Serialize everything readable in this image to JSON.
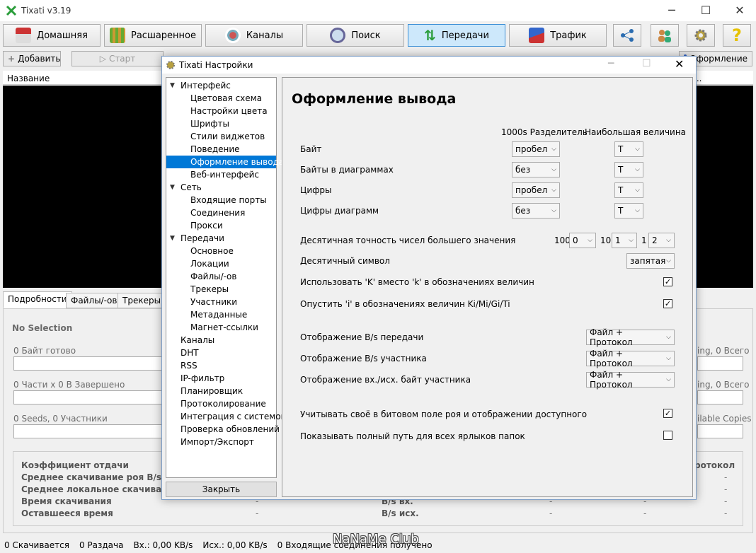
{
  "app": {
    "title": "Tixati v3.19",
    "minimize": "─",
    "maximize": "☐",
    "close": "✕"
  },
  "toolbar": {
    "home": "Домашняя",
    "advanced": "Расшаренное",
    "channels": "Каналы",
    "search": "Поиск",
    "transfers": "Передачи",
    "traffic": "Трафик"
  },
  "row2": {
    "add": "Добавить",
    "start": "Старт",
    "appearance": "Оформление"
  },
  "list": {
    "col_name": "Название",
    "dots": "..."
  },
  "bottom_tabs": [
    "Подробности",
    "Файлы/-ов",
    "Трекеры"
  ],
  "details": {
    "no_selection": "No Selection",
    "bytes_ready": "0 Байт готово",
    "parts": "0 Части  x  0 В Завершено",
    "seeds": "0 Seeds, 0 Участники",
    "right1": "ing, 0 Всего",
    "right2": "ing, 0 Всего",
    "right3": "ilable Copies",
    "stats_labels": [
      "Коэффициент отдачи",
      "Среднее скачивание роя B/s",
      "Среднее локальное скачивание B/s",
      "Время скачивания",
      "Оставшееся время"
    ],
    "bs_in": "B/s вх.",
    "bs_out": "B/s исх.",
    "protocol": "ротокол",
    "dash": "-"
  },
  "status": {
    "downloading": "0 Скачивается",
    "seeding": "0 Раздача",
    "in": "Вх.: 0,00 KB/s",
    "out": "Исх.: 0,00 KB/s",
    "incoming": "0 Входящие соединения получено"
  },
  "watermark": "NaNaMe Club",
  "dialog": {
    "title": "Tixati Настройки",
    "close_btn": "Закрыть",
    "tree": [
      {
        "label": "Интерфейс",
        "level": 1,
        "expanded": true
      },
      {
        "label": "Цветовая схема",
        "level": 2
      },
      {
        "label": "Настройки цвета",
        "level": 2
      },
      {
        "label": "Шрифты",
        "level": 2
      },
      {
        "label": "Стили виджетов",
        "level": 2
      },
      {
        "label": "Поведение",
        "level": 2
      },
      {
        "label": "Оформление вывода",
        "level": 2,
        "selected": true
      },
      {
        "label": "Веб-интерфейс",
        "level": 2
      },
      {
        "label": "Сеть",
        "level": 1,
        "expanded": true
      },
      {
        "label": "Входящие порты",
        "level": 2
      },
      {
        "label": "Соединения",
        "level": 2
      },
      {
        "label": "Прокси",
        "level": 2
      },
      {
        "label": "Передачи",
        "level": 1,
        "expanded": true
      },
      {
        "label": "Основное",
        "level": 2
      },
      {
        "label": "Локации",
        "level": 2
      },
      {
        "label": "Файлы/-ов",
        "level": 2
      },
      {
        "label": "Трекеры",
        "level": 2
      },
      {
        "label": "Участники",
        "level": 2
      },
      {
        "label": "Метаданные",
        "level": 2
      },
      {
        "label": "Магнет-ссылки",
        "level": 2
      },
      {
        "label": "Каналы",
        "level": 1
      },
      {
        "label": "DHT",
        "level": 1
      },
      {
        "label": "RSS",
        "level": 1
      },
      {
        "label": "IP-фильтр",
        "level": 1
      },
      {
        "label": "Планировщик",
        "level": 1
      },
      {
        "label": "Протоколирование",
        "level": 1
      },
      {
        "label": "Интеграция с системой",
        "level": 1
      },
      {
        "label": "Проверка обновлений",
        "level": 1
      },
      {
        "label": "Импорт/Экспорт",
        "level": 1
      }
    ],
    "panel": {
      "title": "Оформление вывода",
      "hdr_sep": "1000s Разделитель",
      "hdr_max": "Наибольшая величина",
      "rows": [
        {
          "label": "Байт",
          "sep": "пробел",
          "max": "T"
        },
        {
          "label": "Байты в диаграммах",
          "sep": "без",
          "max": "T"
        },
        {
          "label": "Цифры",
          "sep": "пробел",
          "max": "T"
        },
        {
          "label": "Цифры диаграмм",
          "sep": "без",
          "max": "T"
        }
      ],
      "precision": {
        "label": "Десятичная точность чисел большего значения",
        "v100_label": "100",
        "v100": "0",
        "v10_label": "10",
        "v10": "1",
        "v1_label": "1",
        "v1": "2"
      },
      "decimal": {
        "label": "Десятичный символ",
        "value": "запятая"
      },
      "use_k": {
        "label": "Использовать 'K' вместо 'k' в обозначениях величин",
        "checked": "✓"
      },
      "omit_i": {
        "label": "Опустить 'i' в обозначениях величин Ki/Mi/Gi/Ti",
        "checked": "✓"
      },
      "bs_transfer": {
        "label": "Отображение B/s передачи",
        "value": "Файл + Протокол"
      },
      "bs_peer": {
        "label": "Отображение B/s участника",
        "value": "Файл + Протокол"
      },
      "bytes_peer": {
        "label": "Отображение вх./исх. байт участника",
        "value": "Файл + Протокол"
      },
      "count_own": {
        "label": "Учитывать своё в битовом поле роя и отображении доступного",
        "checked": "✓"
      },
      "full_path": {
        "label": "Показывать полный путь для всех ярлыков папок",
        "checked": ""
      }
    }
  }
}
